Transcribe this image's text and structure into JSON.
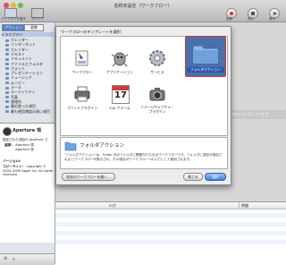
{
  "window": {
    "title": "名称未設定（ワークフロー）"
  },
  "toolbar": {
    "library_label": "ライブラリを隠す",
    "media_label": "メディア",
    "buttons": [
      "記録",
      "停止",
      "実行"
    ]
  },
  "library": {
    "segments": [
      "アクション",
      "変数"
    ],
    "root": "ライブラリ",
    "items": [
      "カレンダー",
      "インターネット",
      "カレンダー",
      "テキスト",
      "ドキュメント",
      "ファイルとフォルダ",
      "フォント",
      "プレゼンテーション",
      "ミュージック",
      "ムービー",
      "メール",
      "ユーティリティ",
      "写真",
      "連絡先",
      "最近使った項目",
      "最も使用頻度の高い項目"
    ]
  },
  "detail": {
    "app_name": "Aperture 項",
    "app_desc": "指定された項目の Aperture で",
    "rows": [
      {
        "key": "結果：",
        "value": "Aperture 項"
      },
      {
        "key": "",
        "value": "Aperture 項"
      },
      {
        "key": "バージョン：",
        "value": "1.0"
      },
      {
        "key": "コピーライト：",
        "value": "Copyright © 2004–2009 Apple Inc. All rights reserved."
      }
    ]
  },
  "workflow_hint": "動をドラッグしてくださ",
  "log": {
    "columns": [
      "ログ",
      "時間"
    ]
  },
  "sheet": {
    "prompt": "ワークフローのテンプレートを選択：",
    "templates": [
      {
        "label": "ワークフロー",
        "icon": "workflow-icon"
      },
      {
        "label": "アプリケーション",
        "icon": "application-icon"
      },
      {
        "label": "サービス",
        "icon": "service-gear-icon"
      },
      {
        "label": "フォルダアクション",
        "icon": "folder-icon",
        "selected": true
      },
      {
        "label": "プリントプラグイン",
        "icon": "printer-icon"
      },
      {
        "label": "iCal アラーム",
        "icon": "calendar-icon"
      },
      {
        "label": "イメージキャプチャ・プラグイン",
        "icon": "camera-icon"
      }
    ],
    "calendar_day": "17",
    "info_title": "フォルダアクション",
    "info_text": "\"フォルダアクション\"は、Finder 内のフォルダに関連付けられるワークフローです。フォルダに項目が追加されるとワークフローが実行され、その項目がワークフローへの入力として使用されます。",
    "open_existing": "既存のワークフローを開く...",
    "close": "閉じる",
    "choose": "選択"
  },
  "colors": {
    "selection": "#3d6fc4",
    "folder": "#6fa2dc"
  }
}
